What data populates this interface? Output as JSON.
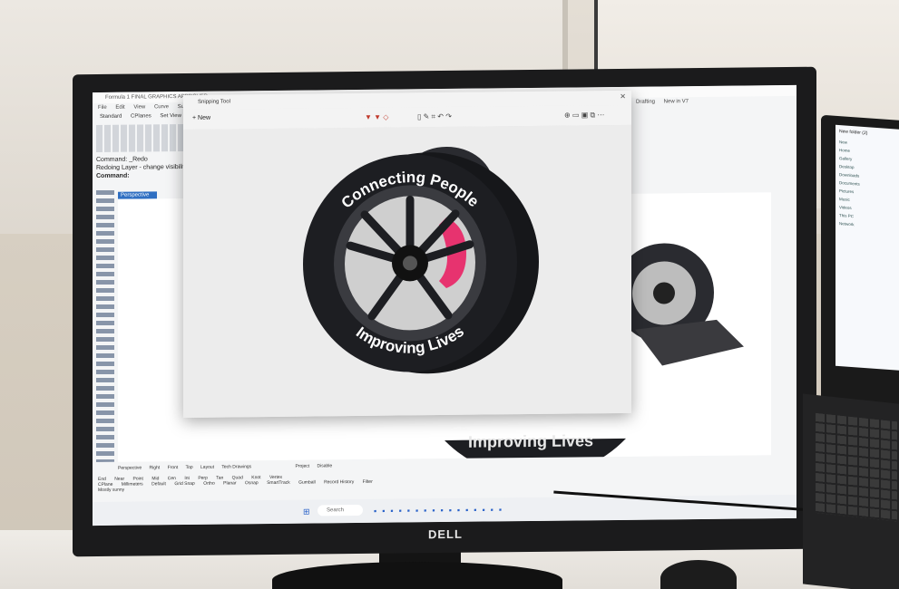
{
  "cad": {
    "window_title": "Formula 1 FINAL GRAPHICS APPROVED",
    "menu": [
      "File",
      "Edit",
      "View",
      "Curve",
      "Surface",
      "Drafting",
      "New in V7"
    ],
    "tabs": [
      "Standard",
      "CPlanes",
      "Set View"
    ],
    "command_history": [
      "Command: _Redo",
      "Redoing Layer - change visibility"
    ],
    "command_prompt": "Command:",
    "viewport_label": "Perspective",
    "bottom_tabs": [
      "Perspective",
      "Right",
      "Front",
      "Top",
      "Layout",
      "Tech Drawings"
    ],
    "osnaps": [
      "End",
      "Near",
      "Point",
      "Mid",
      "Cen",
      "Int",
      "Perp",
      "Tan",
      "Quad",
      "Knot",
      "Vertex",
      "Project",
      "Disable"
    ],
    "status": [
      "CPlane",
      "Millimeters",
      "Default",
      "Grid Snap",
      "Ortho",
      "Planar",
      "Osnap",
      "SmartTrack",
      "Gumball",
      "Record History",
      "Filter"
    ],
    "status_hint": "Mostly sunny"
  },
  "snip": {
    "title": "Snipping Tool",
    "new_label": "New",
    "text_top": "Connecting People",
    "text_bottom": "Improving Lives"
  },
  "back_render": {
    "text_bottom": "Improving Lives"
  },
  "taskbar": {
    "search_placeholder": "Search"
  },
  "monitor": {
    "brand": "DELL"
  },
  "laptop": {
    "window_title": "New folder (2)",
    "new_label": "New",
    "items": [
      "Home",
      "Gallery",
      "Desktop",
      "Downloads",
      "Documents",
      "Pictures",
      "Music",
      "Videos",
      "This PC",
      "Network"
    ]
  },
  "colors": {
    "accent_pink": "#e7336f",
    "tire_black": "#1d1e22",
    "rhino_blue": "#2f6fc2"
  }
}
